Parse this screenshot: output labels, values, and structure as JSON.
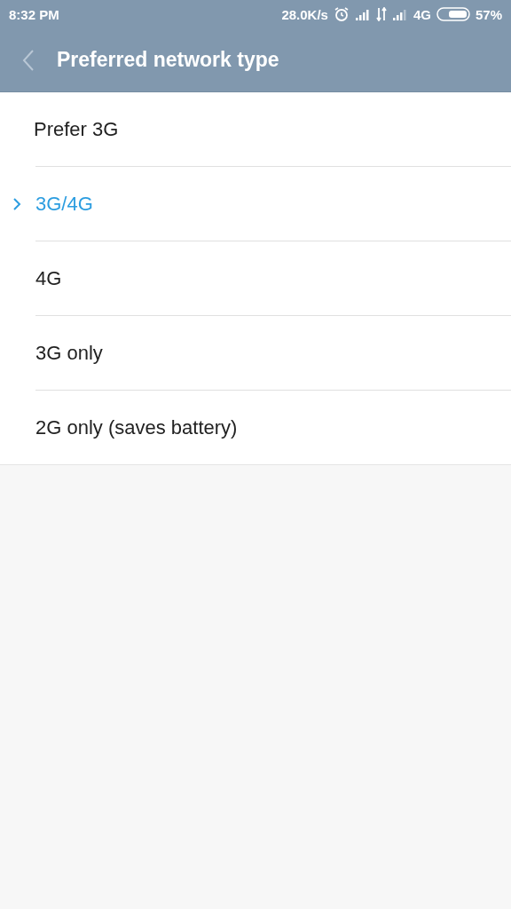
{
  "status_bar": {
    "time": "8:32 PM",
    "speed": "28.0K/s",
    "network": "4G",
    "battery": "57%"
  },
  "header": {
    "title": "Preferred network type"
  },
  "options": [
    {
      "label": "Prefer 3G",
      "selected": false
    },
    {
      "label": "3G/4G",
      "selected": true
    },
    {
      "label": "4G",
      "selected": false
    },
    {
      "label": "3G only",
      "selected": false
    },
    {
      "label": "2G only (saves battery)",
      "selected": false
    }
  ]
}
